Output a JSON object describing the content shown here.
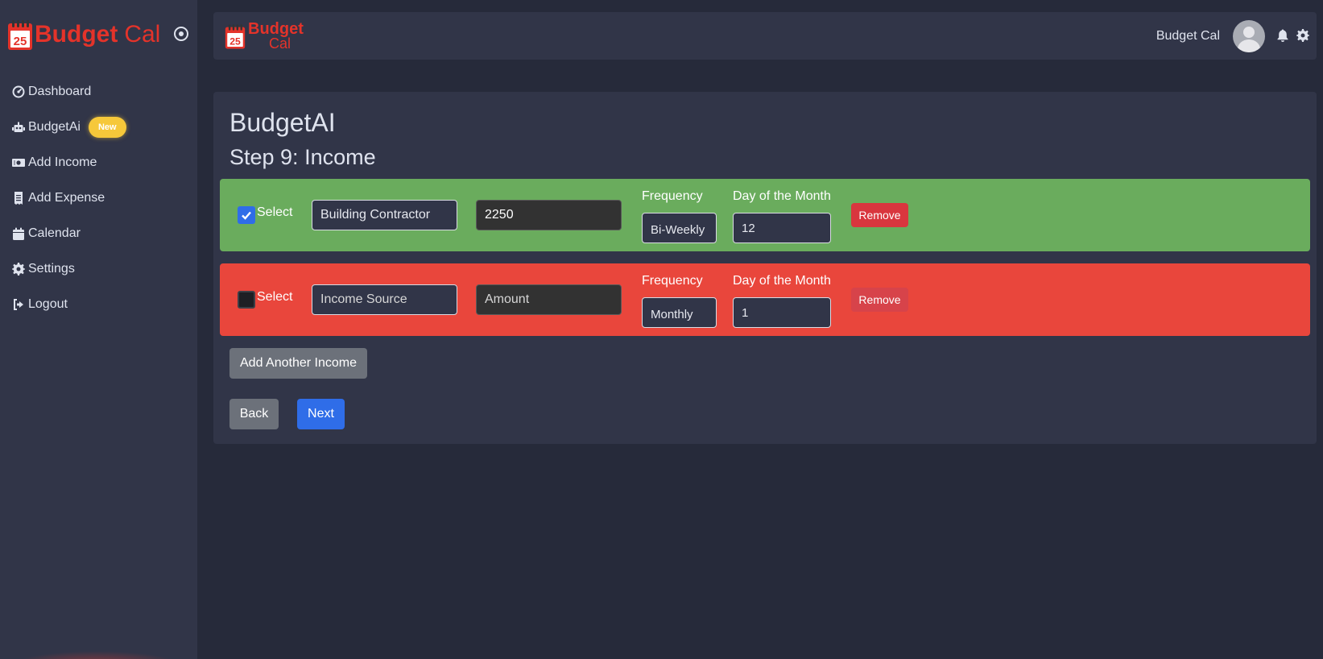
{
  "app": {
    "brand_bold": "Budget",
    "brand_light": "Cal",
    "logo_day": "25",
    "colors": {
      "brand_red": "#e4332a",
      "accent_blue": "#2f6de8",
      "row_selected": "#6aac5d",
      "row_unselected": "#e9463c"
    }
  },
  "sidebar": {
    "items": [
      {
        "label": "Dashboard",
        "icon": "gauge-icon"
      },
      {
        "label": "BudgetAi",
        "icon": "robot-icon",
        "badge": "New"
      },
      {
        "label": "Add Income",
        "icon": "money-bill-icon"
      },
      {
        "label": "Add Expense",
        "icon": "receipt-icon"
      },
      {
        "label": "Calendar",
        "icon": "calendar-icon"
      },
      {
        "label": "Settings",
        "icon": "gear-icon"
      },
      {
        "label": "Logout",
        "icon": "logout-icon"
      }
    ]
  },
  "header": {
    "brand_top": "Budget",
    "brand_bottom": "Cal",
    "user_name": "Budget Cal"
  },
  "main": {
    "title": "BudgetAI",
    "step": "Step 9: Income",
    "select_label": "Select",
    "frequency_label": "Frequency",
    "day_label": "Day of the Month",
    "remove_label": "Remove",
    "incomes": [
      {
        "selected": true,
        "source": "Building Contractor",
        "source_placeholder": "Income Source",
        "amount": "2250",
        "amount_placeholder": "Amount",
        "frequency": "Bi-Weekly",
        "day": "12"
      },
      {
        "selected": false,
        "source": "",
        "source_placeholder": "Income Source",
        "amount": "",
        "amount_placeholder": "Amount",
        "frequency": "Monthly",
        "day": "1"
      }
    ],
    "add_label": "Add Another Income",
    "back_label": "Back",
    "next_label": "Next"
  }
}
